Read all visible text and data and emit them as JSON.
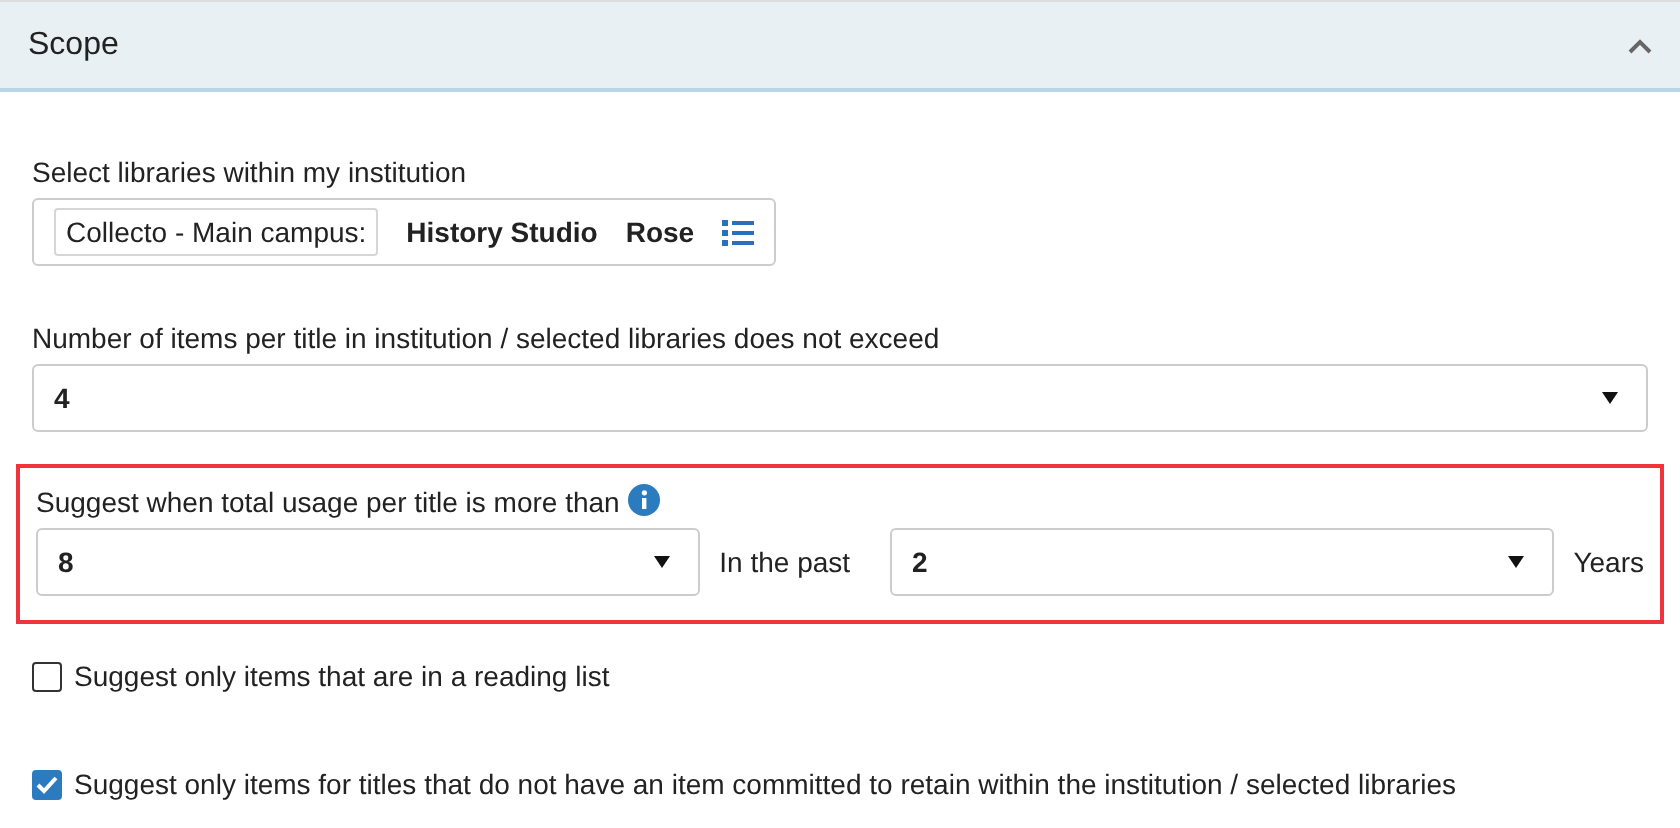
{
  "section": {
    "title": "Scope",
    "expanded": true
  },
  "libraries": {
    "label": "Select libraries within my institution",
    "items": [
      {
        "kind": "input",
        "text": "Collecto - Main campus:"
      },
      {
        "kind": "tag",
        "text": "History Studio"
      },
      {
        "kind": "tag",
        "text": "Rose"
      }
    ]
  },
  "items_limit": {
    "label": "Number of items per title in institution / selected libraries does not exceed",
    "value": "4"
  },
  "usage": {
    "highlighted": true,
    "label": "Suggest when total usage per title is more than",
    "count": "8",
    "between": "In the past",
    "period": "2",
    "unit": "Years"
  },
  "options": [
    {
      "label": "Suggest only items that are in a reading list",
      "checked": false
    },
    {
      "label": "Suggest only items for titles that do not have an item committed to retain within the institution / selected libraries",
      "checked": true
    }
  ]
}
